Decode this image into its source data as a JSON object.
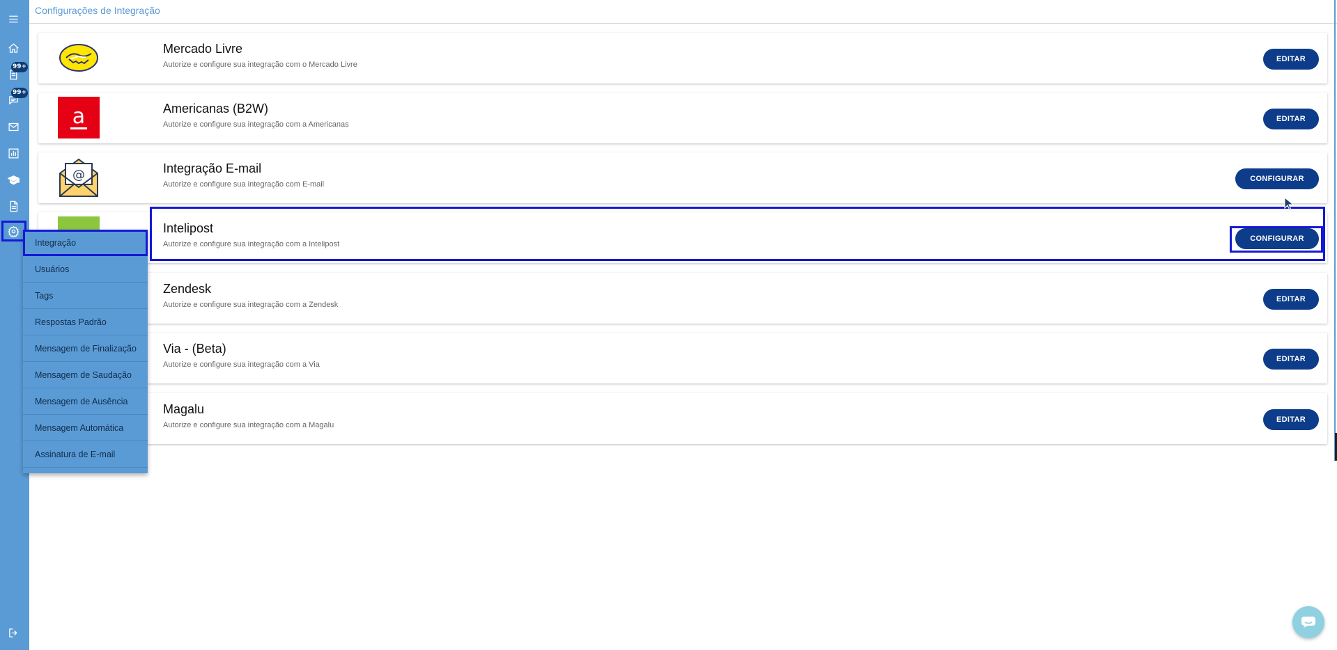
{
  "header": {
    "title": "Configurações de Integração"
  },
  "sidebar": {
    "icons": [
      {
        "name": "hamburger-menu-icon"
      },
      {
        "name": "home-icon"
      },
      {
        "name": "tickets-icon",
        "badge": "99+"
      },
      {
        "name": "chat-icon",
        "badge": "99+"
      },
      {
        "name": "mail-icon"
      },
      {
        "name": "reports-icon"
      },
      {
        "name": "training-icon"
      },
      {
        "name": "document-icon"
      },
      {
        "name": "settings-icon"
      },
      {
        "name": "logout-icon"
      }
    ]
  },
  "settings_menu": {
    "items": [
      {
        "label": "Integração",
        "active": true
      },
      {
        "label": "Usuários"
      },
      {
        "label": "Tags"
      },
      {
        "label": "Respostas Padrão"
      },
      {
        "label": "Mensagem de Finalização"
      },
      {
        "label": "Mensagem de Saudação"
      },
      {
        "label": "Mensagem de Ausência"
      },
      {
        "label": "Mensagem Automática"
      },
      {
        "label": "Assinatura de E-mail"
      }
    ]
  },
  "integrations": [
    {
      "title": "Mercado Livre",
      "subtitle": "Autorize e configure sua integração com o Mercado Livre",
      "button": "EDITAR",
      "logo": "mercado-livre-logo"
    },
    {
      "title": "Americanas (B2W)",
      "subtitle": "Autorize e configure sua integração com a Americanas",
      "button": "EDITAR",
      "logo": "americanas-logo"
    },
    {
      "title": "Integração E-mail",
      "subtitle": "Autorize e configure sua integração com E-mail",
      "button": "CONFIGURAR",
      "logo": "email-envelope-logo"
    },
    {
      "title": "Intelipost",
      "subtitle": "Autorize e configure sua integração com a Intelipost",
      "button": "CONFIGURAR",
      "logo": "intelipost-logo"
    },
    {
      "title": "Zendesk",
      "subtitle": "Autorize e configure sua integração com a Zendesk",
      "button": "EDITAR",
      "logo": "zendesk-logo"
    },
    {
      "title": "Via - (Beta)",
      "subtitle": "Autorize e configure sua integração com a Via",
      "button": "EDITAR",
      "logo": "via-logo"
    },
    {
      "title": "Magalu",
      "subtitle": "Autorize e configure sua integração com a Magalu",
      "button": "EDITAR",
      "logo": "magalu-logo"
    }
  ],
  "colors": {
    "sidebar": "#5b9bd5",
    "button": "#0d3c8a",
    "highlight": "#1419d6",
    "americanas_red": "#e60014"
  }
}
